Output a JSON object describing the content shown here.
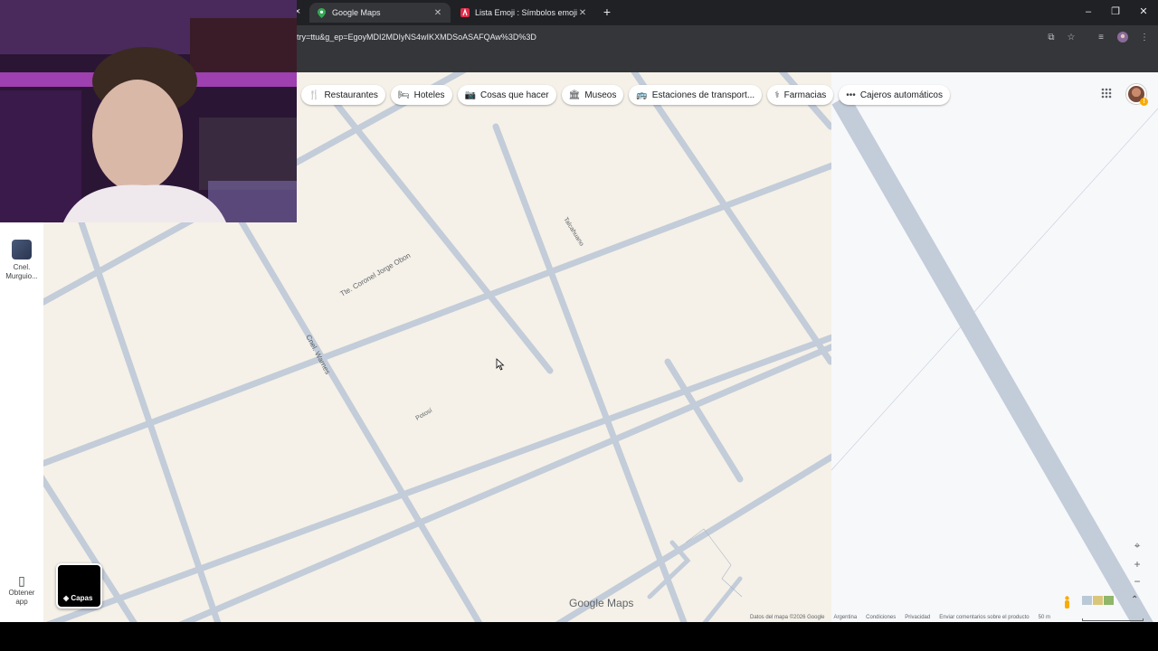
{
  "browser": {
    "tabs": [
      {
        "title": "Google Maps",
        "active": true
      },
      {
        "title": "Lista Emoji : Símbolos emoji na",
        "active": false
      }
    ],
    "url": "try=ttu&g_ep=EgoyMDI2MDIyNS4wIKXMDSoASAFQAw%3D%3D"
  },
  "categories": [
    {
      "label": "Restaurantes",
      "icon": "fork-knife-icon"
    },
    {
      "label": "Hoteles",
      "icon": "bed-icon"
    },
    {
      "label": "Cosas que hacer",
      "icon": "camera-icon"
    },
    {
      "label": "Museos",
      "icon": "museum-icon"
    },
    {
      "label": "Estaciones de transport...",
      "icon": "bus-icon"
    },
    {
      "label": "Farmacias",
      "icon": "pharmacy-icon"
    },
    {
      "label": "Cajeros automáticos",
      "icon": "atm-icon"
    }
  ],
  "sidebar": {
    "saved_place": {
      "label_line1": "Cnel.",
      "label_line2": "Murguio..."
    },
    "get_app": {
      "label_line1": "Obtener",
      "label_line2": "app"
    }
  },
  "map": {
    "streets": [
      "Tte. Coronel Jorge Obon",
      "Cnel. Warnes",
      "Talcahuano",
      "Potosí"
    ],
    "layers_label": "Capas",
    "logo_google": "Google",
    "logo_maps": "Maps"
  },
  "footer": {
    "data": "Datos del mapa ©2026 Google",
    "country": "Argentina",
    "terms": "Condiciones",
    "privacy": "Privacidad",
    "feedback": "Enviar comentarios sobre el producto",
    "scale": "50 m"
  },
  "colors": {
    "road": "#c3ccd9",
    "land": "#f5f1e8",
    "chrome_dark": "#202124",
    "chrome_mid": "#35363a"
  }
}
